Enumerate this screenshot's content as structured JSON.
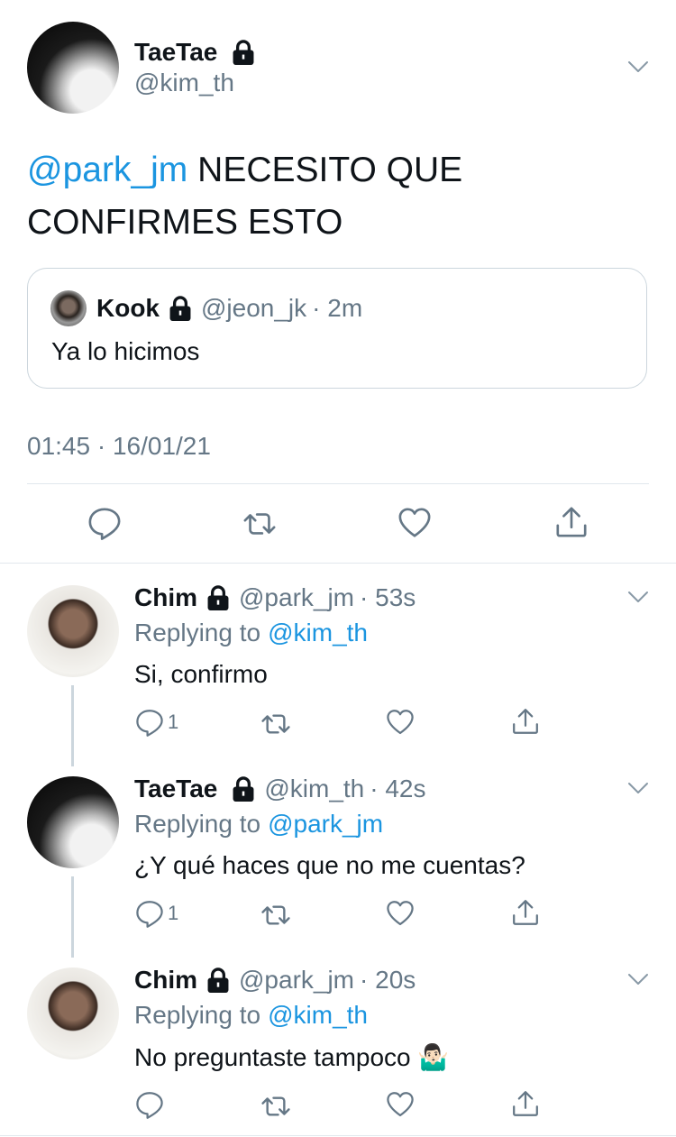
{
  "main_tweet": {
    "author_name": "TaeTae",
    "author_handle": "@kim_th",
    "text_mention": "@park_jm",
    "text_line1": "NECESITO QUE",
    "text_line2": "CONFIRMES ESTO",
    "timestamp": "01:45 · 16/01/21"
  },
  "quoted_tweet": {
    "author_name": "Kook",
    "author_handle": "@jeon_jk",
    "time": "· 2m",
    "text": "Ya lo hicimos"
  },
  "replies": [
    {
      "author_name": "Chim",
      "author_handle": "@park_jm",
      "time": "· 53s",
      "replying_prefix": "Replying to",
      "replying_to": "@kim_th",
      "text": "Si, confirmo",
      "reply_count": "1"
    },
    {
      "author_name": "TaeTae",
      "author_handle": "@kim_th",
      "time": "· 42s",
      "replying_prefix": "Replying to",
      "replying_to": "@park_jm",
      "text": "¿Y qué haces que no me cuentas?",
      "reply_count": "1"
    },
    {
      "author_name": "Chim",
      "author_handle": "@park_jm",
      "time": "· 20s",
      "replying_prefix": "Replying to",
      "replying_to": "@kim_th",
      "text": "No preguntaste tampoco 🤷🏻‍♂️",
      "reply_count": ""
    }
  ],
  "icons": [
    "lock-icon",
    "chevron-down-icon",
    "reply-icon",
    "retweet-icon",
    "like-icon",
    "share-icon"
  ],
  "colors": {
    "accent": "#1b95e0",
    "secondary_text": "#657786",
    "divider": "#e1e8ed"
  }
}
